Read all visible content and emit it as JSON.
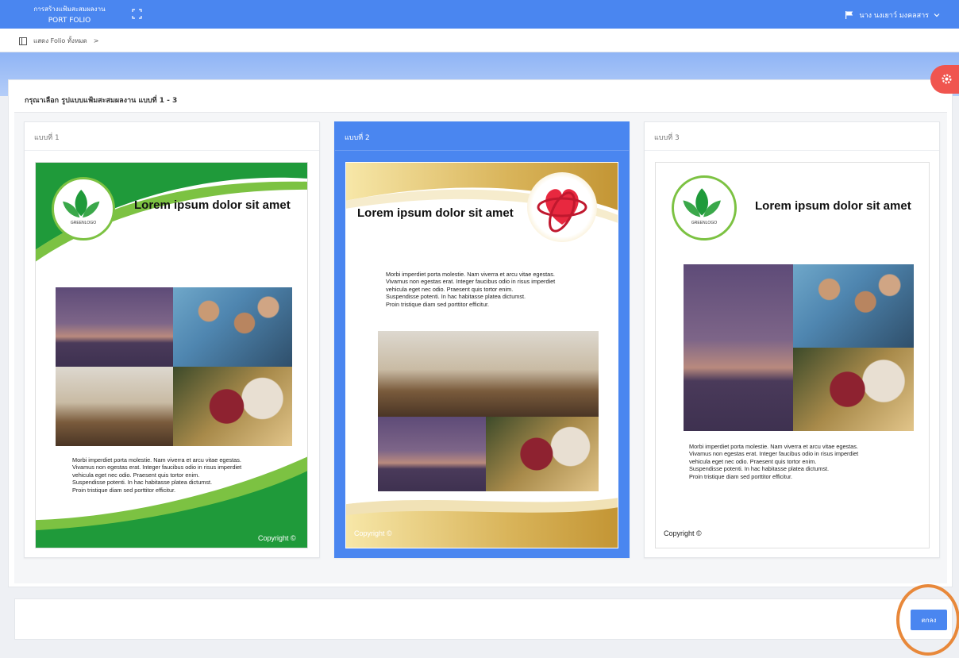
{
  "app": {
    "title_line1": "การสร้างแฟ้มสะสมผลงาน",
    "title_line2": "PORT FOLIO",
    "user_name": "นาง นงเยาว์ มงคลสาร"
  },
  "breadcrumb": {
    "label": "แสดง Folio ทั้งหมด",
    "separator": ">"
  },
  "panel": {
    "title": "กรุณาเลือก รูปแบบแฟ้มสะสมผลงาน แบบที่ 1 - 3"
  },
  "templates": [
    {
      "label": "แบบที่ 1",
      "selected": false,
      "heading": "Lorem ipsum dolor sit amet",
      "logo_text": "GREENLOGO",
      "body": "Morbi imperdiet porta molestie. Nam viverra et arcu vitae egestas.\nVivamus non egestas erat. Integer faucibus odio in risus imperdiet\nvehicula eget nec odio. Praesent quis tortor enim.\nSuspendisse potenti. In hac habitasse platea dictumst.\nProin tristique diam sed porttitor efficitur.",
      "copyright": "Copyright ©"
    },
    {
      "label": "แบบที่ 2",
      "selected": true,
      "heading": "Lorem ipsum dolor sit amet",
      "body": "Morbi imperdiet porta molestie. Nam viverra et arcu vitae egestas.\nVivamus non egestas erat. Integer faucibus odio in risus imperdiet\nvehicula eget nec odio. Praesent quis tortor enim.\nSuspendisse potenti. In hac habitasse platea dictumst.\nProin tristique diam sed porttitor efficitur.",
      "copyright": "Copyright ©"
    },
    {
      "label": "แบบที่ 3",
      "selected": false,
      "heading": "Lorem ipsum dolor sit amet",
      "logo_text": "GREENLOGO",
      "body": "Morbi imperdiet porta molestie. Nam viverra et arcu vitae egestas.\nVivamus non egestas erat. Integer faucibus odio in risus imperdiet\nvehicula eget nec odio. Praesent quis tortor enim.\nSuspendisse potenti. In hac habitasse platea dictumst.\nProin tristique diam sed porttitor efficitur.",
      "copyright": "Copyright ©"
    }
  ],
  "actions": {
    "ok_label": "ตกลง"
  },
  "colors": {
    "primary": "#4a86f0",
    "settings": "#f0554f",
    "highlight": "#e8883a",
    "green": "#1f9a3a",
    "gold": "#d4a94a"
  }
}
